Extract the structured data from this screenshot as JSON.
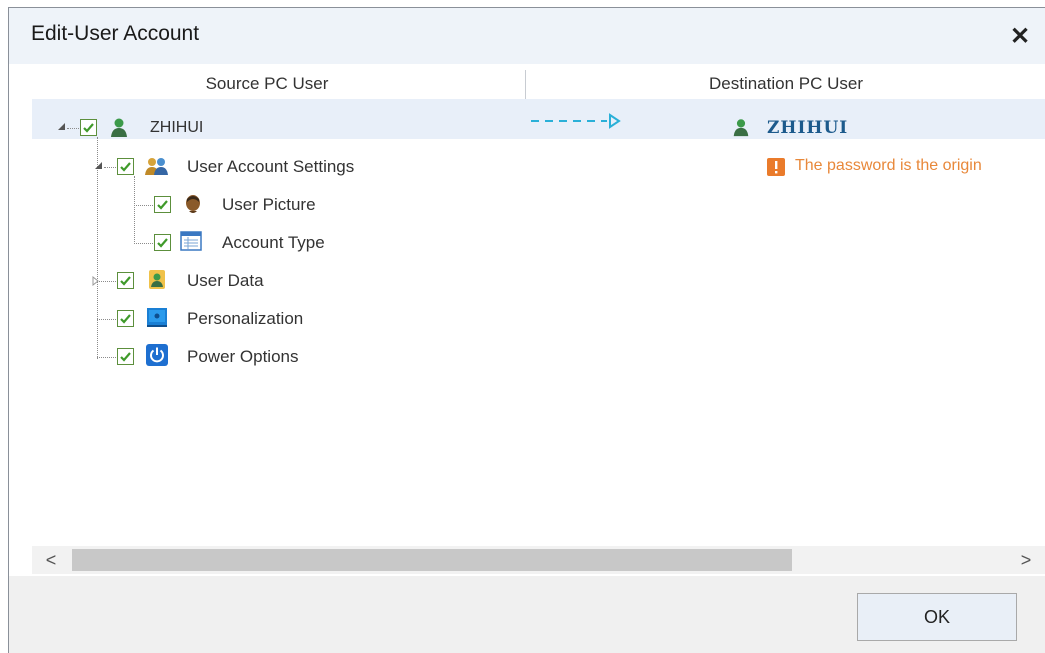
{
  "dialog": {
    "title": "Edit-User Account"
  },
  "columns": {
    "source": "Source PC User",
    "destination": "Destination PC User"
  },
  "tree": {
    "root": {
      "label": "ZHIHUI",
      "checked": true,
      "expanded": true
    },
    "account_settings": {
      "label": "User Account Settings",
      "checked": true,
      "expanded": true
    },
    "user_picture": {
      "label": "User Picture",
      "checked": true
    },
    "account_type": {
      "label": "Account Type",
      "checked": true
    },
    "user_data": {
      "label": "User Data",
      "checked": true,
      "expanded": false
    },
    "personalization": {
      "label": "Personalization",
      "checked": true
    },
    "power_options": {
      "label": "Power Options",
      "checked": true
    }
  },
  "destination": {
    "user": "ZHIHUI",
    "warning": "The password is the origin"
  },
  "scrollbar": {
    "left_arrow": "<",
    "right_arrow": ">"
  },
  "footer": {
    "ok_label": "OK"
  },
  "colors": {
    "check_green": "#3f9a2a",
    "dest_user_blue": "#1c5a8c",
    "warning_orange": "#e8883a",
    "arrow_cyan": "#2ab0d8"
  }
}
